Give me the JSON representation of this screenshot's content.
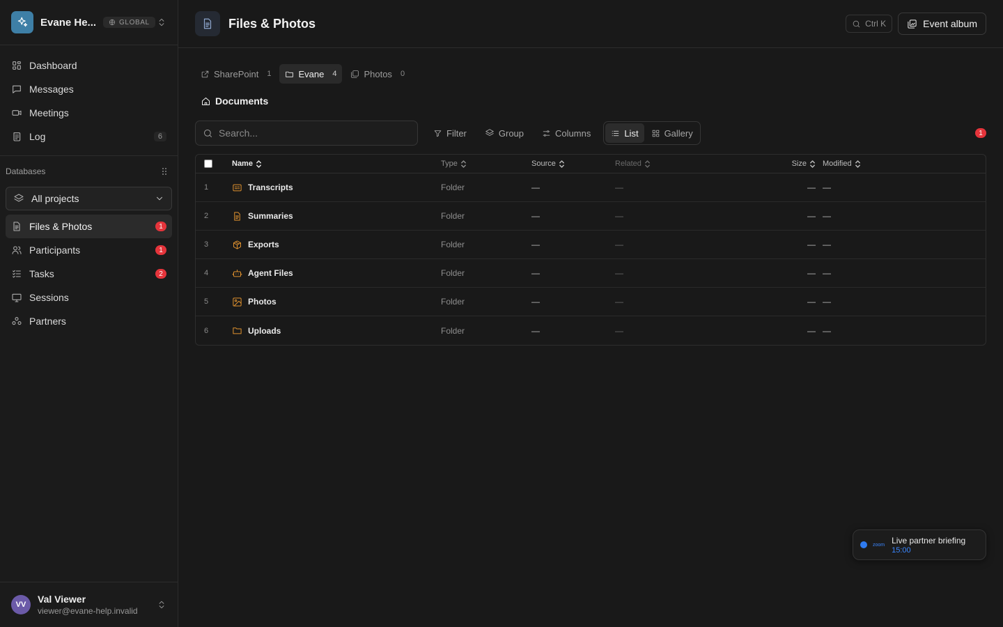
{
  "workspace": {
    "name": "Evane He...",
    "badge": "GLOBAL"
  },
  "nav": [
    {
      "label": "Dashboard",
      "icon": "dashboard-icon"
    },
    {
      "label": "Messages",
      "icon": "message-icon"
    },
    {
      "label": "Meetings",
      "icon": "video-icon"
    },
    {
      "label": "Log",
      "icon": "log-icon",
      "count": "6"
    }
  ],
  "databases": {
    "heading": "Databases",
    "project_select": "All projects",
    "items": [
      {
        "label": "Files & Photos",
        "icon": "file-icon",
        "badge": "1",
        "active": true
      },
      {
        "label": "Participants",
        "icon": "users-icon",
        "badge": "1"
      },
      {
        "label": "Tasks",
        "icon": "tasks-icon",
        "badge": "2"
      },
      {
        "label": "Sessions",
        "icon": "session-icon"
      },
      {
        "label": "Partners",
        "icon": "partners-icon"
      }
    ]
  },
  "user": {
    "initials": "VV",
    "name": "Val Viewer",
    "email": "viewer@evane-help.invalid"
  },
  "header": {
    "title": "Files & Photos",
    "shortcut": "Ctrl K",
    "action": "Event album"
  },
  "tabs": [
    {
      "label": "SharePoint",
      "count": "1"
    },
    {
      "label": "Evane",
      "count": "4",
      "active": true
    },
    {
      "label": "Photos",
      "count": "0"
    }
  ],
  "breadcrumb": "Documents",
  "toolbar": {
    "search_placeholder": "Search...",
    "filter": "Filter",
    "group": "Group",
    "columns": "Columns",
    "list": "List",
    "gallery": "Gallery",
    "notification_count": "1"
  },
  "table": {
    "columns": [
      "Name",
      "Type",
      "Source",
      "Related",
      "Size",
      "Modified"
    ],
    "rows": [
      {
        "idx": "1",
        "name": "Transcripts",
        "type": "Folder",
        "source": "—",
        "related": "—",
        "size": "—",
        "modified": "—"
      },
      {
        "idx": "2",
        "name": "Summaries",
        "type": "Folder",
        "source": "—",
        "related": "—",
        "size": "—",
        "modified": "—"
      },
      {
        "idx": "3",
        "name": "Exports",
        "type": "Folder",
        "source": "—",
        "related": "—",
        "size": "—",
        "modified": "—"
      },
      {
        "idx": "4",
        "name": "Agent Files",
        "type": "Folder",
        "source": "—",
        "related": "—",
        "size": "—",
        "modified": "—"
      },
      {
        "idx": "5",
        "name": "Photos",
        "type": "Folder",
        "source": "—",
        "related": "—",
        "size": "—",
        "modified": "—"
      },
      {
        "idx": "6",
        "name": "Uploads",
        "type": "Folder",
        "source": "—",
        "related": "—",
        "size": "—",
        "modified": "—"
      }
    ]
  },
  "toast": {
    "brand": "zoom",
    "title": "Live partner briefing",
    "time": "15:00"
  },
  "colors": {
    "accent_red": "#e5343b",
    "folder_orange": "#e0922f",
    "zoom_blue": "#2f7bf0",
    "logo_blue": "#3e7fa6",
    "avatar_purple": "#6b5aa8"
  }
}
